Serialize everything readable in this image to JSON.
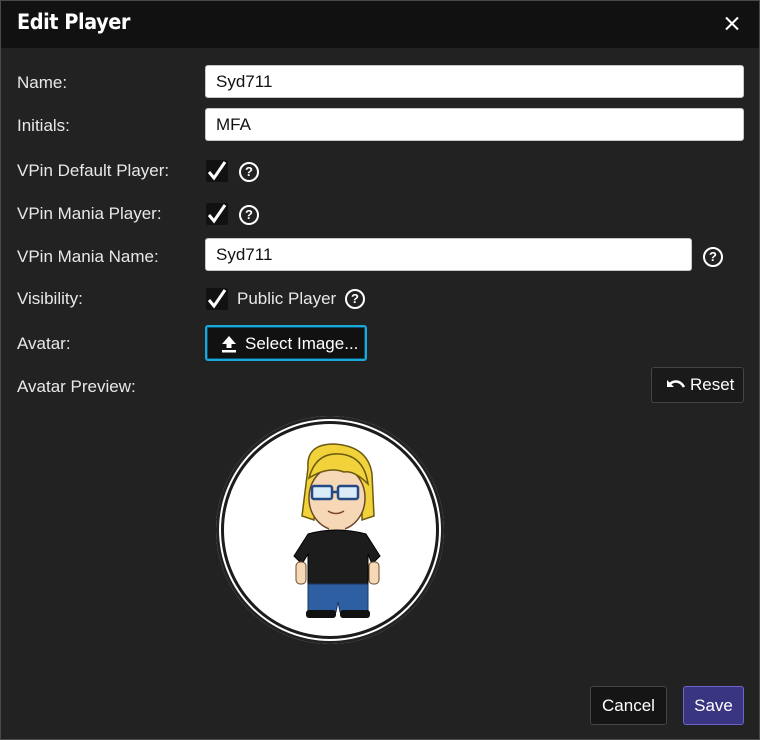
{
  "dialog": {
    "title": "Edit Player"
  },
  "form": {
    "name_label": "Name:",
    "name_value": "Syd711",
    "initials_label": "Initials:",
    "initials_value": "MFA",
    "vpin_default_label": "VPin Default Player:",
    "vpin_default_checked": true,
    "vpin_mania_player_label": "VPin Mania Player:",
    "vpin_mania_player_checked": true,
    "vpin_mania_name_label": "VPin Mania Name:",
    "vpin_mania_name_value": "Syd711",
    "visibility_label": "Visibility:",
    "public_player_label": "Public Player",
    "public_player_checked": true,
    "avatar_label": "Avatar:",
    "select_image_label": "Select Image...",
    "avatar_preview_label": "Avatar Preview:",
    "reset_label": "Reset"
  },
  "footer": {
    "cancel_label": "Cancel",
    "save_label": "Save"
  },
  "colors": {
    "background": "#222222",
    "titlebar": "#111111",
    "accent_border": "#1aa8d8",
    "save_button": "#3a3580"
  },
  "icons": [
    "close-icon",
    "checkmark-icon",
    "help-icon",
    "upload-icon",
    "undo-icon"
  ]
}
